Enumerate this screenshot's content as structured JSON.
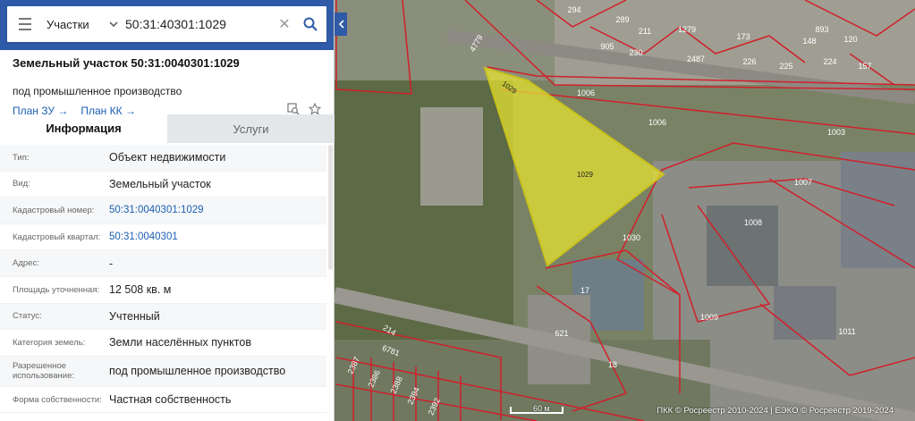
{
  "search": {
    "scope": "Участки",
    "query": "50:31:40301:1029"
  },
  "parcel": {
    "title": "Земельный участок 50:31:0040301:1029",
    "subtitle": "под промышленное производство",
    "plan_zu": "План ЗУ",
    "plan_kk": "План КК"
  },
  "tabs": {
    "info": "Информация",
    "services": "Услуги"
  },
  "rows": [
    {
      "k": "Тип:",
      "v": "Объект недвижимости"
    },
    {
      "k": "Вид:",
      "v": "Земельный участок"
    },
    {
      "k": "Кадастровый номер:",
      "v": "50:31:0040301:1029"
    },
    {
      "k": "Кадастровый квартал:",
      "v": "50:31:0040301"
    },
    {
      "k": "Адрес:",
      "v": "-"
    },
    {
      "k": "Площадь уточненная:",
      "v": "12 508 кв. м"
    },
    {
      "k": "Статус:",
      "v": "Учтенный"
    },
    {
      "k": "Категория земель:",
      "v": "Земли населённых пунктов"
    },
    {
      "k": "Разрешенное использование:",
      "v": "под промышленное производство"
    },
    {
      "k": "Форма собственности:",
      "v": "Частная собственность"
    }
  ],
  "map": {
    "attribution": "ПКК © Росреестр 2010-2024 | ЕЭКО © Росреестр 2019-2024",
    "scale_label": "60 м",
    "highlight_color": "#e6e233",
    "boundary_color": "#d0202a",
    "labels": {
      "selected": "1029",
      "edge": "1029",
      "p1006": "1006",
      "p1006b": "1006",
      "p1003": "1003",
      "p1007": "1007",
      "p1008": "1008",
      "p1030": "1030",
      "p1009": "1009",
      "p1011": "1011",
      "p17": "17",
      "p621": "621",
      "p18": "18",
      "p4779": "4779",
      "p905": "905",
      "p230": "230",
      "p289": "289",
      "p211": "211",
      "p2487": "2487",
      "p226": "226",
      "p225": "225",
      "p224": "224",
      "p157": "157",
      "p893": "893",
      "p120": "120",
      "p148": "148",
      "p173": "173",
      "p1279": "1279",
      "p214": "214",
      "p2386": "2386",
      "p2387": "2387",
      "p2392": "2392",
      "p2394": "2394",
      "p2388": "2388",
      "p294": "294",
      "p6781": "6781"
    }
  }
}
